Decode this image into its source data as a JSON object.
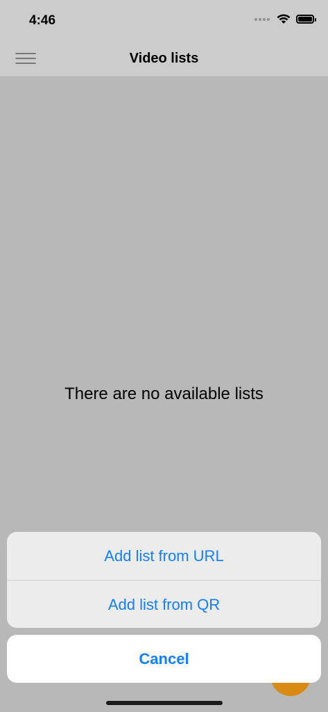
{
  "status_bar": {
    "time": "4:46",
    "icons": [
      "signal-icon",
      "wifi-icon",
      "battery-icon"
    ]
  },
  "nav_bar": {
    "title": "Video lists",
    "menu_icon": "hamburger-menu-icon"
  },
  "content": {
    "empty_message": "There are no available lists"
  },
  "fab": {
    "icon": "plus-icon",
    "label": "+",
    "color": "#d88a14"
  },
  "action_sheet": {
    "items": [
      {
        "label": "Add list from URL"
      },
      {
        "label": "Add list from QR"
      }
    ],
    "cancel_label": "Cancel",
    "accent_color": "#147efb"
  }
}
